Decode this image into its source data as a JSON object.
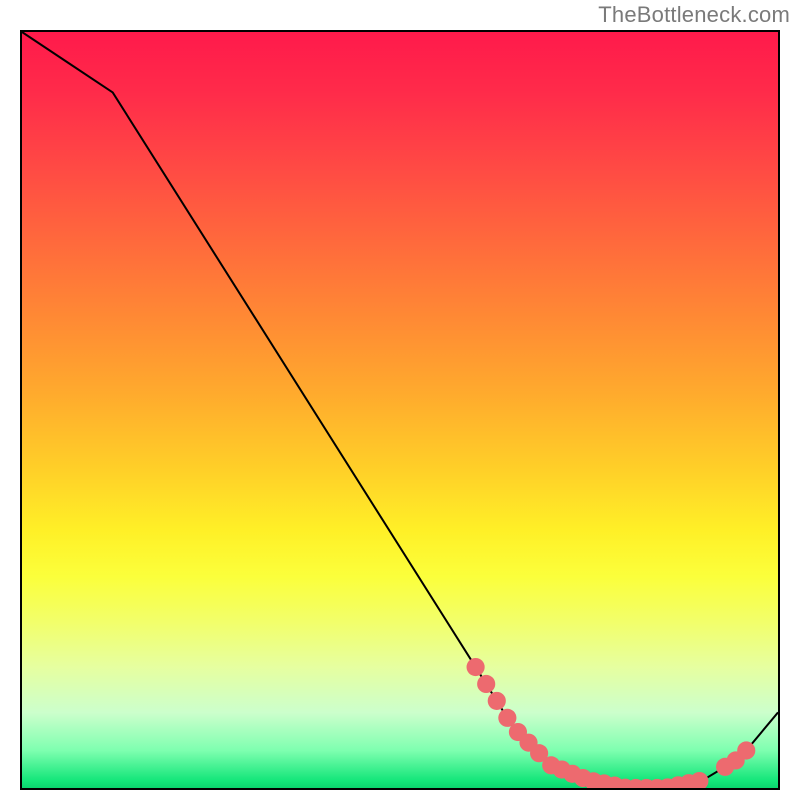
{
  "attribution": "TheBottleneck.com",
  "chart_data": {
    "type": "line",
    "title": "",
    "xlabel": "",
    "ylabel": "",
    "xlim": [
      0,
      100
    ],
    "ylim": [
      0,
      100
    ],
    "x": [
      0,
      6,
      12,
      60,
      65,
      70,
      75,
      80,
      85,
      90,
      95,
      100
    ],
    "values": [
      100,
      96,
      92,
      16,
      8,
      3,
      1,
      0,
      0,
      1,
      4,
      10
    ],
    "marker_regions": [
      {
        "x_start": 60,
        "x_end": 69
      },
      {
        "x_start": 70,
        "x_end": 90
      },
      {
        "x_start": 93,
        "x_end": 96
      }
    ],
    "curve_color": "#000000",
    "marker_color": "#ed6a6f",
    "marker_radius_pct": 1.2
  },
  "gradient_stops": [
    {
      "pct": 0,
      "color": "#ff1a4b"
    },
    {
      "pct": 50,
      "color": "#ffd028"
    },
    {
      "pct": 75,
      "color": "#f8ff40"
    },
    {
      "pct": 95,
      "color": "#7fffb0"
    },
    {
      "pct": 100,
      "color": "#0bd46e"
    }
  ]
}
